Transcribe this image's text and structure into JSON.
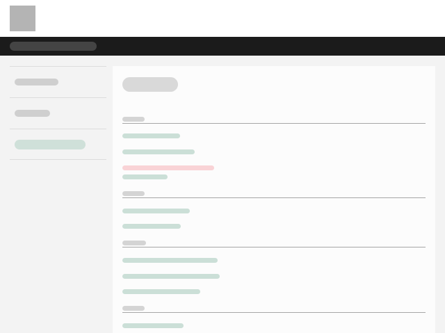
{
  "header": {
    "logo_icon": "logo-placeholder-icon",
    "nav_text": "",
    "title": ""
  },
  "sidebar": {
    "items": [
      {
        "label": ""
      },
      {
        "label": ""
      },
      {
        "label": ""
      }
    ],
    "active_index": 2
  },
  "main": {
    "sections": [
      {
        "heading": "",
        "links": [
          "",
          "",
          ""
        ]
      },
      {
        "heading": "",
        "links": [
          "",
          ""
        ]
      },
      {
        "heading": "",
        "links": [
          "",
          "",
          ""
        ]
      },
      {
        "heading": "",
        "links": [
          ""
        ]
      }
    ]
  },
  "colors": {
    "topbar": "#1b1b1b",
    "link_accent": "#cbdfd7",
    "error_accent": "#f9d3d6",
    "logo": "#b4b4b4"
  }
}
